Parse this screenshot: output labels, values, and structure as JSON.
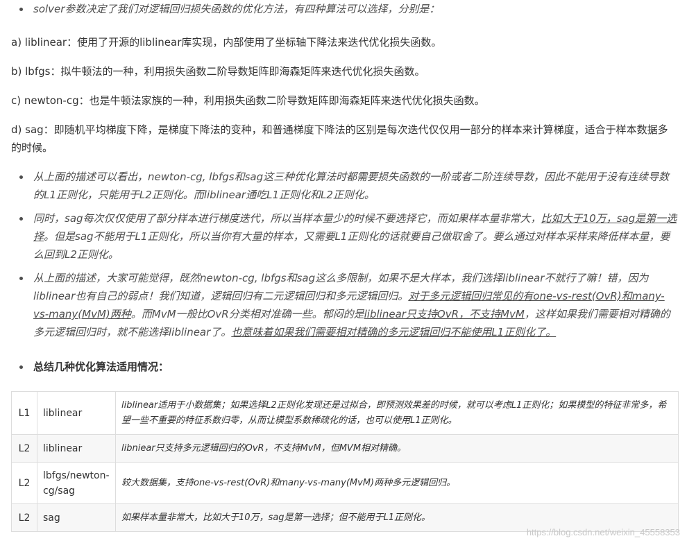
{
  "intro_bullet": {
    "text": "solver参数决定了我们对逻辑回归损失函数的优化方法，有四种算法可以选择，分别是："
  },
  "options": [
    {
      "text": "a) liblinear：使用了开源的liblinear库实现，内部使用了坐标轴下降法来迭代优化损失函数。"
    },
    {
      "text": "b) lbfgs：拟牛顿法的一种，利用损失函数二阶导数矩阵即海森矩阵来迭代优化损失函数。"
    },
    {
      "text": "c) newton-cg：也是牛顿法家族的一种，利用损失函数二阶导数矩阵即海森矩阵来迭代优化损失函数。"
    },
    {
      "text": "d) sag：即随机平均梯度下降，是梯度下降法的变种，和普通梯度下降法的区别是每次迭代仅仅用一部分的样本来计算梯度，适合于样本数据多的时候。"
    }
  ],
  "notes": [
    {
      "parts": [
        {
          "text": "从上面的描述可以看出，newton-cg, lbfgs和sag这三种优化算法时都需要损失函数的一阶或者二阶连续导数，因此不能用于没有连续导数的L1正则化，只能用于L2正则化。而liblinear通吃L1正则化和L2正则化。",
          "u": false
        }
      ]
    },
    {
      "parts": [
        {
          "text": "同时，sag每次仅仅使用了部分样本进行梯度迭代，所以当样本量少的时候不要选择它，而如果样本量非常大，",
          "u": false
        },
        {
          "text": "比如大于10万，sag是第一选择",
          "u": true
        },
        {
          "text": "。但是sag不能用于L1正则化，所以当你有大量的样本，又需要L1正则化的话就要自己做取舍了。要么通过对样本采样来降低样本量，要么回到L2正则化。",
          "u": false
        }
      ]
    },
    {
      "parts": [
        {
          "text": "从上面的描述，大家可能觉得，既然newton-cg, lbfgs和sag这么多限制，如果不是大样本，我们选择liblinear不就行了嘛！错，因为liblinear也有自己的弱点！我们知道，逻辑回归有二元逻辑回归和多元逻辑回归。",
          "u": false
        },
        {
          "text": "对于多元逻辑回归常见的有one-vs-rest(OvR)和many-vs-many(MvM)两种",
          "u": true
        },
        {
          "text": "。而MvM一般比OvR分类相对准确一些。郁闷的是",
          "u": false
        },
        {
          "text": "liblinear只支持OvR，不支持MvM",
          "u": true
        },
        {
          "text": "，这样如果我们需要相对精确的多元逻辑回归时，就不能选择liblinear了。",
          "u": false
        },
        {
          "text": "也意味着如果我们需要相对精确的多元逻辑回归不能使用L1正则化了。",
          "u": true
        }
      ]
    }
  ],
  "summary_heading": "总结几种优化算法适用情况：",
  "table": {
    "rows": [
      {
        "penalty": "L1",
        "solver": "liblinear",
        "desc": "liblinear适用于小数据集；如果选择L2正则化发现还是过拟合，即预测效果差的时候，就可以考虑L1正则化；如果模型的特征非常多，希望一些不重要的特征系数归零，从而让模型系数稀疏化的话，也可以使用L1正则化。"
      },
      {
        "penalty": "L2",
        "solver": "liblinear",
        "desc": "libniear只支持多元逻辑回归的OvR，不支持MvM，但MVM相对精确。"
      },
      {
        "penalty": "L2",
        "solver": "lbfgs/newton-cg/sag",
        "desc": "较大数据集，支持one-vs-rest(OvR)和many-vs-many(MvM)两种多元逻辑回归。"
      },
      {
        "penalty": "L2",
        "solver": "sag",
        "desc": "如果样本量非常大，比如大于10万，sag是第一选择；但不能用于L1正则化。"
      }
    ]
  },
  "watermark": "https://blog.csdn.net/weixin_45558353"
}
